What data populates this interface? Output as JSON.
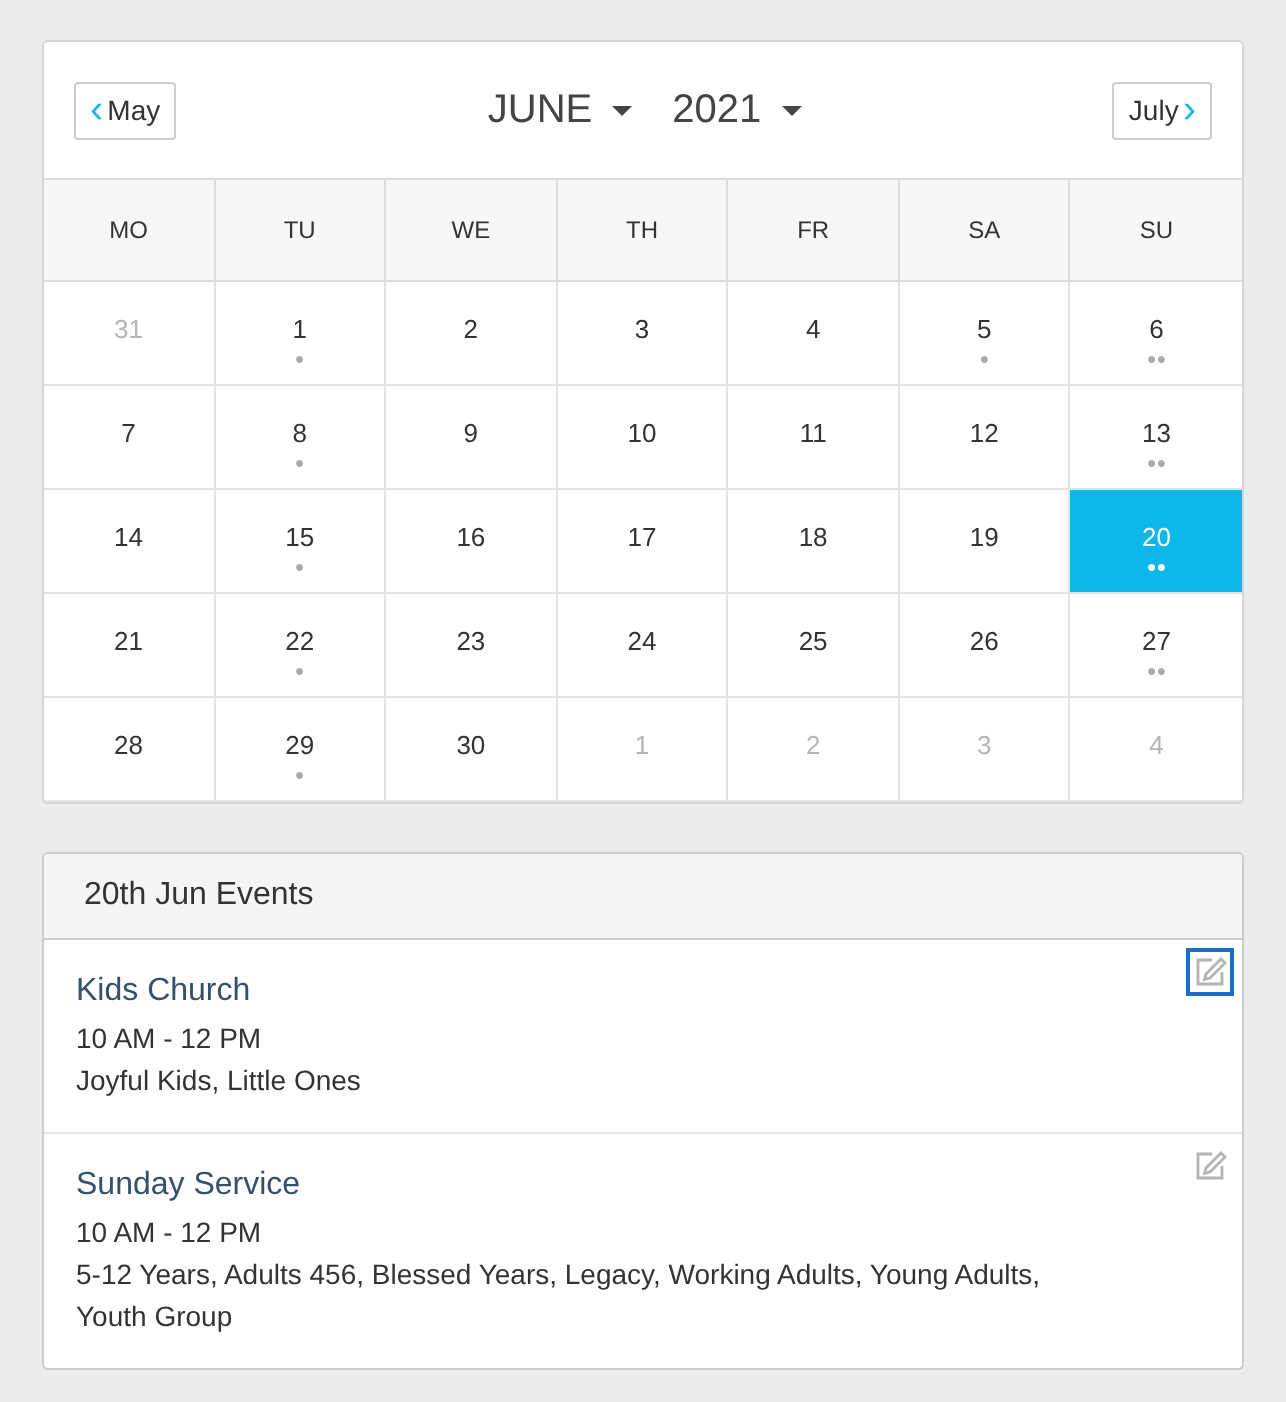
{
  "calendar": {
    "prev_button": {
      "label": "May",
      "icon": "‹"
    },
    "month": "JUNE",
    "year": "2021",
    "next_button": {
      "label": "July",
      "icon": "›"
    },
    "weekdays": [
      "MO",
      "TU",
      "WE",
      "TH",
      "FR",
      "SA",
      "SU"
    ],
    "weeks": [
      [
        {
          "day": "31",
          "other_month": true,
          "selected": false
        },
        {
          "day": "1",
          "dots": "●",
          "other_month": false,
          "selected": false
        },
        {
          "day": "2",
          "other_month": false,
          "selected": false
        },
        {
          "day": "3",
          "other_month": false,
          "selected": false
        },
        {
          "day": "4",
          "other_month": false,
          "selected": false
        },
        {
          "day": "5",
          "dots": "●",
          "other_month": false,
          "selected": false
        },
        {
          "day": "6",
          "dots": "●●",
          "other_month": false,
          "selected": false
        }
      ],
      [
        {
          "day": "7",
          "other_month": false,
          "selected": false
        },
        {
          "day": "8",
          "dots": "●",
          "other_month": false,
          "selected": false
        },
        {
          "day": "9",
          "other_month": false,
          "selected": false
        },
        {
          "day": "10",
          "other_month": false,
          "selected": false
        },
        {
          "day": "11",
          "other_month": false,
          "selected": false
        },
        {
          "day": "12",
          "other_month": false,
          "selected": false
        },
        {
          "day": "13",
          "dots": "●●",
          "other_month": false,
          "selected": false
        }
      ],
      [
        {
          "day": "14",
          "other_month": false,
          "selected": false
        },
        {
          "day": "15",
          "dots": "●",
          "other_month": false,
          "selected": false
        },
        {
          "day": "16",
          "other_month": false,
          "selected": false
        },
        {
          "day": "17",
          "other_month": false,
          "selected": false
        },
        {
          "day": "18",
          "other_month": false,
          "selected": false
        },
        {
          "day": "19",
          "other_month": false,
          "selected": false
        },
        {
          "day": "20",
          "dots": "●●",
          "other_month": false,
          "selected": true
        }
      ],
      [
        {
          "day": "21",
          "other_month": false,
          "selected": false
        },
        {
          "day": "22",
          "dots": "●",
          "other_month": false,
          "selected": false
        },
        {
          "day": "23",
          "other_month": false,
          "selected": false
        },
        {
          "day": "24",
          "other_month": false,
          "selected": false
        },
        {
          "day": "25",
          "other_month": false,
          "selected": false
        },
        {
          "day": "26",
          "other_month": false,
          "selected": false
        },
        {
          "day": "27",
          "dots": "●●",
          "other_month": false,
          "selected": false
        }
      ],
      [
        {
          "day": "28",
          "other_month": false,
          "selected": false
        },
        {
          "day": "29",
          "dots": "●",
          "other_month": false,
          "selected": false
        },
        {
          "day": "30",
          "other_month": false,
          "selected": false
        },
        {
          "day": "1",
          "other_month": true,
          "selected": false
        },
        {
          "day": "2",
          "other_month": true,
          "selected": false
        },
        {
          "day": "3",
          "other_month": true,
          "selected": false
        },
        {
          "day": "4",
          "other_month": true,
          "selected": false
        }
      ]
    ]
  },
  "events": {
    "title": "20th Jun Events",
    "items": [
      {
        "name": "Kids Church",
        "time": "10 AM - 12 PM",
        "groups": "Joyful Kids, Little Ones",
        "focused": true
      },
      {
        "name": "Sunday Service",
        "time": "10 AM - 12 PM",
        "groups": "5-12 Years, Adults 456, Blessed Years, Legacy, Working Adults, Young Adults, Youth Group",
        "focused": false
      }
    ]
  }
}
